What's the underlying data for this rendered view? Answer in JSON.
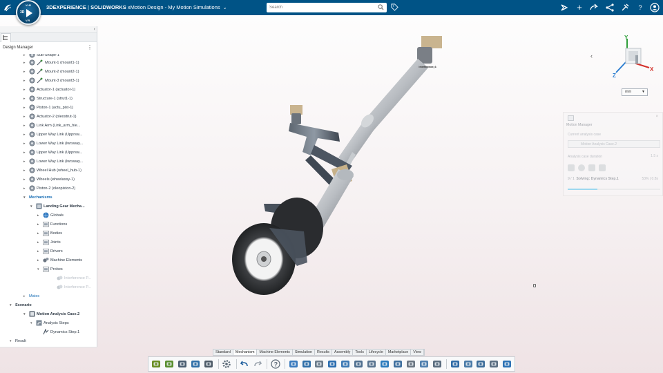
{
  "topbar": {
    "brand_bold": "3DEXPERIENCE",
    "brand_sep": " | ",
    "brand_sw": "SOLIDWORKS",
    "app_name": "xMotion Design",
    "separator": " - ",
    "doc_name": "My Motion Simulations",
    "search_placeholder": "Search",
    "compass_labels": {
      "left": "3D",
      "top": "V+R",
      "bottom": "V.R"
    },
    "bg_color": "#005386"
  },
  "left_panel": {
    "title": "Design Manager",
    "tree": [
      {
        "label": "Sub-Shape-1",
        "indent": 1,
        "icon": "part-icon",
        "expander": "▸"
      },
      {
        "label": "Mount-1 (mount1-1)",
        "indent": 1,
        "icon": "part-icon",
        "expander": "▸"
      },
      {
        "label": "Mount-2 (mount2-1)",
        "indent": 1,
        "icon": "part-icon",
        "expander": "▸"
      },
      {
        "label": "Mount-3 (mount3-1)",
        "indent": 1,
        "icon": "part-icon",
        "expander": "▸"
      },
      {
        "label": "Actuator-1 (actuator-1)",
        "indent": 1,
        "icon": "part-icon",
        "expander": "▸"
      },
      {
        "label": "Structure-1 (strut1-1)",
        "indent": 1,
        "icon": "part-icon",
        "expander": "▸"
      },
      {
        "label": "Piston-1 (actu_pist-1)",
        "indent": 1,
        "icon": "part-icon",
        "expander": "▸"
      },
      {
        "label": "Actuator-2 (oleostrut-1)",
        "indent": 1,
        "icon": "part-icon",
        "expander": "▸"
      },
      {
        "label": "Link Arm (Link_arm_hie...",
        "indent": 1,
        "icon": "part-icon",
        "expander": "▸"
      },
      {
        "label": "Upper Way Link (Upprsw...",
        "indent": 1,
        "icon": "part-icon",
        "expander": "▸"
      },
      {
        "label": "Lower Way Link (lwrsway...",
        "indent": 1,
        "icon": "part-icon",
        "expander": "▸"
      },
      {
        "label": "Upper Way Link (Upprsw...",
        "indent": 1,
        "icon": "part-icon",
        "expander": "▸"
      },
      {
        "label": "Lower Way Link (lwrsway...",
        "indent": 1,
        "icon": "part-icon",
        "expander": "▸"
      },
      {
        "label": "Wheel Hub (wheel_hub-1)",
        "indent": 1,
        "icon": "part-icon",
        "expander": "▸"
      },
      {
        "label": "Wheels (wheelassy-1)",
        "indent": 1,
        "icon": "part-icon",
        "expander": "▸"
      },
      {
        "label": "Piston-2 (oleopiston-2)",
        "indent": 1,
        "icon": "part-icon",
        "expander": "▸"
      },
      {
        "label": "Mechanisms",
        "indent": 1,
        "icon": "",
        "expander": "▾",
        "style": "bold blue"
      },
      {
        "label": "Landing Gear Mecha...",
        "indent": 2,
        "icon": "mechanism-icon",
        "expander": "▾",
        "style": "bold"
      },
      {
        "label": "Globals",
        "indent": 3,
        "icon": "globe-icon",
        "expander": "▸"
      },
      {
        "label": "Functions",
        "indent": 3,
        "icon": "folder-icon",
        "expander": "▸"
      },
      {
        "label": "Bodies",
        "indent": 3,
        "icon": "folder-icon",
        "expander": "▸"
      },
      {
        "label": "Joints",
        "indent": 3,
        "icon": "folder-icon",
        "expander": "▸"
      },
      {
        "label": "Drivers",
        "indent": 3,
        "icon": "folder-icon",
        "expander": "▸"
      },
      {
        "label": "Machine Elements",
        "indent": 3,
        "icon": "gears-icon",
        "expander": "▸"
      },
      {
        "label": "Probes",
        "indent": 3,
        "icon": "folder-icon",
        "expander": "▾"
      },
      {
        "label": "Interference P...",
        "indent": 4,
        "icon": "probe-icon",
        "expander": "",
        "style": "faded"
      },
      {
        "label": "Interference P...",
        "indent": 4,
        "icon": "probe-icon",
        "expander": "",
        "style": "faded"
      },
      {
        "label": "Mates",
        "indent": 1,
        "icon": "",
        "expander": "▸",
        "style": "blue"
      },
      {
        "label": "Scenario",
        "indent": 0,
        "icon": "",
        "expander": "▾",
        "style": "bold"
      },
      {
        "label": "Motion Analysis Case.2",
        "indent": 1,
        "icon": "analysis-case-icon",
        "expander": "▾",
        "style": "bold"
      },
      {
        "label": "Analysis Steps",
        "indent": 2,
        "icon": "steps-icon",
        "expander": "▾"
      },
      {
        "label": "Dynamics Step.1",
        "indent": 3,
        "icon": "dynamics-icon",
        "expander": ""
      },
      {
        "label": "Result",
        "indent": 0,
        "icon": "",
        "expander": "▾"
      }
    ]
  },
  "viewport": {
    "annotation": "Interference_1",
    "unit": "mm",
    "axis_x": "X",
    "axis_y": "Y",
    "axis_z": "Z"
  },
  "motion_manager": {
    "title": "Motion Manager",
    "current_case_label": "Current analysis case",
    "current_case_value": "Motion Analysis Case.2",
    "duration_label": "Analysis case duration",
    "duration_value": "1.5 s",
    "step_counter": "9 / 1",
    "step_name": "Solving: Dynamics Step.1",
    "progress_text": "53% | 0.8s",
    "progress": 0.53
  },
  "bottom": {
    "tabs": [
      "Standard",
      "Mechanism",
      "Machine Elements",
      "Simulation",
      "Results",
      "Assembly",
      "Tools",
      "Lifecycle",
      "Marketplace",
      "View"
    ],
    "active_tab": "Mechanism",
    "tools": [
      {
        "name": "mechanism-icon",
        "color": "#6b8e23"
      },
      {
        "name": "mechanism-auto-icon",
        "color": "#5a8f2f"
      },
      {
        "name": "save-icon",
        "color": "#4a5d70"
      },
      {
        "name": "refresh-icon",
        "color": "#2f6fa8"
      },
      {
        "name": "update-icon",
        "color": "#4e5b68"
      },
      {
        "name": "sep",
        "color": ""
      },
      {
        "name": "settings-gear-icon",
        "color": "#5b6a78"
      },
      {
        "name": "sep",
        "color": ""
      },
      {
        "name": "undo-icon",
        "color": "#1f5f9e"
      },
      {
        "name": "redo-icon",
        "color": "#9aa3ad"
      },
      {
        "name": "sep",
        "color": ""
      },
      {
        "name": "help-icon",
        "color": "#5a6775"
      },
      {
        "name": "sep",
        "color": ""
      },
      {
        "name": "rigid-body-icon",
        "color": "#3a7bbf"
      },
      {
        "name": "fixed-body-icon",
        "color": "#2f6fa8"
      },
      {
        "name": "revolute-joint-icon",
        "color": "#6a7b8a"
      },
      {
        "name": "slider-joint-icon",
        "color": "#2c6eb0"
      },
      {
        "name": "cylindrical-joint-icon",
        "color": "#3b78b4"
      },
      {
        "name": "spring-icon",
        "color": "#4f6f8f"
      },
      {
        "name": "damper-icon",
        "color": "#5a7590"
      },
      {
        "name": "force-icon",
        "color": "#2a7bbd"
      },
      {
        "name": "torque-icon",
        "color": "#3e6f9e"
      },
      {
        "name": "contact-icon",
        "color": "#6b7682"
      },
      {
        "name": "gear-pair-icon",
        "color": "#4f7fae"
      },
      {
        "name": "cam-icon",
        "color": "#5a6c7e"
      },
      {
        "name": "sep",
        "color": ""
      },
      {
        "name": "sensor-icon",
        "color": "#2e6aa6"
      },
      {
        "name": "probe-icon",
        "color": "#4a7ba8"
      },
      {
        "name": "measure-icon",
        "color": "#3d6d9a"
      },
      {
        "name": "interference-icon",
        "color": "#5c6f82"
      },
      {
        "name": "export-icon",
        "color": "#2c72b5"
      }
    ]
  }
}
